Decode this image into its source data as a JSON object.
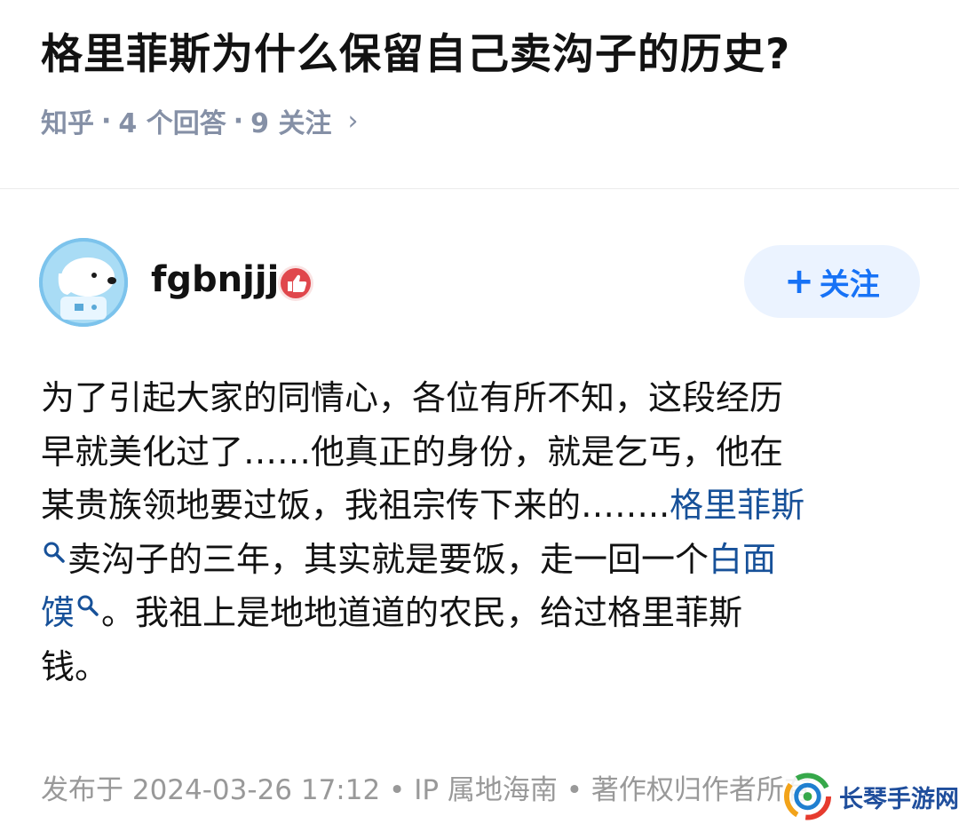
{
  "question": {
    "title": "格里菲斯为什么保留自己卖沟子的历史?",
    "source": "知乎",
    "sep": "·",
    "answers": "4 个回答",
    "follows": "9 关注",
    "chevron": "›"
  },
  "author": {
    "name": "fgbnjjj",
    "badge_icon": "thumbs-up-badge-icon",
    "follow_plus": "+",
    "follow_label": "关注",
    "follow_color": "#1772f6"
  },
  "answer": {
    "line1": "为了引起大家的同情心，各位有所不知，这段经历",
    "line2": "早就美化过了……他真正的身份，就是乞丐，他在",
    "line3_a": "某贵族领地要过饭，我祖宗传下来的……..",
    "line3_link": "格里菲斯",
    "line4_a": "卖沟子的三年，其实就是要饭，走一回一个",
    "line4_link": "白面",
    "line5_link": "馍",
    "line5_b": "。我祖上是地地道道的农民，给过格里菲斯",
    "line6": "钱。",
    "link_color": "#175199",
    "search_icon": "search-icon"
  },
  "footer": {
    "text": "发布于 2024-03-26 17:12 • IP 属地海南 • 著作权归作者所有"
  },
  "watermark": {
    "text": "长琴手游网"
  }
}
